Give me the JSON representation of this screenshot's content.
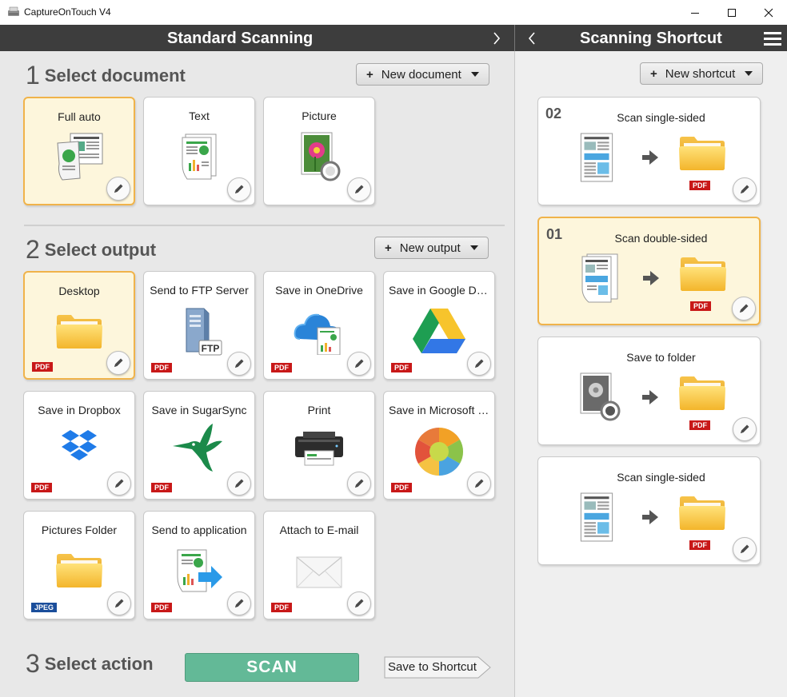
{
  "window": {
    "title": "CaptureOnTouch V4"
  },
  "left_header": {
    "title": "Standard Scanning"
  },
  "right_header": {
    "title": "Scanning Shortcut"
  },
  "step1": {
    "number": "1",
    "label": "Select document",
    "new_button": "New document",
    "tiles": [
      {
        "label": "Full auto",
        "icon": "full-auto-document-icon",
        "selected": true
      },
      {
        "label": "Text",
        "icon": "text-document-icon",
        "selected": false
      },
      {
        "label": "Picture",
        "icon": "picture-document-icon",
        "selected": false
      }
    ]
  },
  "step2": {
    "number": "2",
    "label": "Select output",
    "new_button": "New output",
    "tiles": [
      {
        "label": "Desktop",
        "icon": "folder-icon",
        "badge": "PDF",
        "selected": true
      },
      {
        "label": "Send to FTP Server",
        "icon": "ftp-server-icon",
        "badge": "PDF",
        "icon_text": "FTP"
      },
      {
        "label": "Save in OneDrive",
        "icon": "onedrive-icon",
        "badge": "PDF"
      },
      {
        "label": "Save in Google Dri...",
        "icon": "google-drive-icon",
        "badge": "PDF"
      },
      {
        "label": "Save in Dropbox",
        "icon": "dropbox-icon",
        "badge": "PDF"
      },
      {
        "label": "Save in SugarSync",
        "icon": "sugarsync-icon",
        "badge": "PDF"
      },
      {
        "label": "Print",
        "icon": "printer-icon",
        "badge": ""
      },
      {
        "label": "Save in Microsoft S...",
        "icon": "sharepoint-icon",
        "badge": "PDF"
      },
      {
        "label": "Pictures Folder",
        "icon": "folder-icon",
        "badge": "JPEG"
      },
      {
        "label": "Send to application",
        "icon": "send-to-application-icon",
        "badge": "PDF"
      },
      {
        "label": "Attach to E-mail",
        "icon": "envelope-icon",
        "badge": "PDF"
      }
    ]
  },
  "step3": {
    "number": "3",
    "label": "Select action",
    "scan_button": "SCAN",
    "save_shortcut_button": "Save to Shortcut"
  },
  "shortcuts": {
    "new_button": "New shortcut",
    "items": [
      {
        "number": "02",
        "label": "Scan single-sided",
        "badge": "PDF",
        "selected": false
      },
      {
        "number": "01",
        "label": "Scan double-sided",
        "badge": "PDF",
        "selected": true
      },
      {
        "number": "",
        "label": "Save to folder",
        "badge": "PDF",
        "selected": false
      },
      {
        "number": "",
        "label": "Scan single-sided",
        "badge": "PDF",
        "selected": false
      }
    ]
  },
  "colors": {
    "header_bg": "#3d3d3d",
    "selected_bg": "#fdf6dc",
    "selected_border": "#f0b34a",
    "scan_button": "#63b997",
    "pdf_badge": "#c81818",
    "jpeg_badge": "#1b4e9b"
  }
}
